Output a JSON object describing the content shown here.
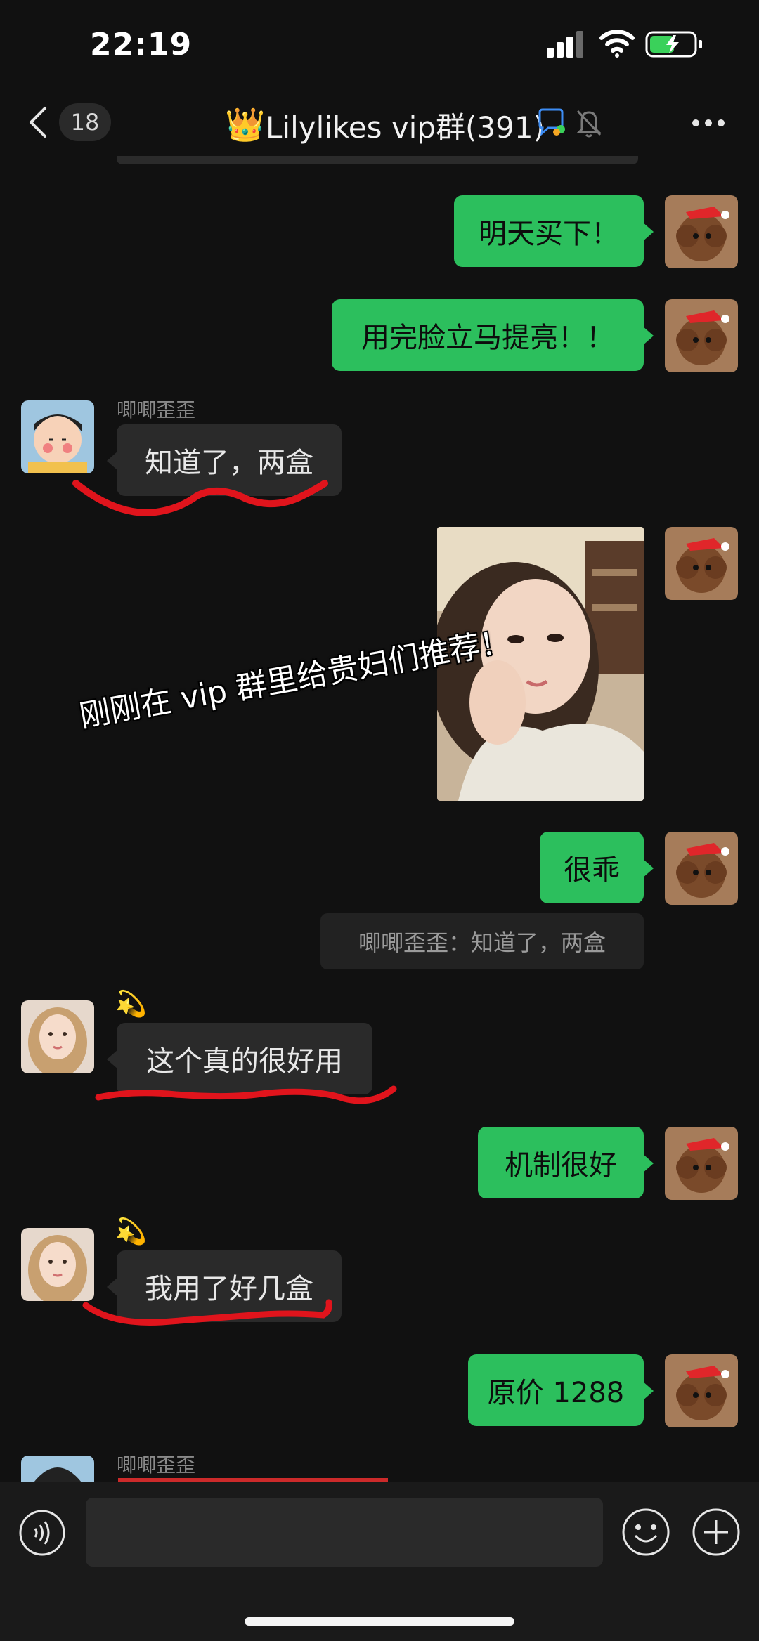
{
  "status_bar": {
    "time": "22:19"
  },
  "nav": {
    "unread_count": "18",
    "crown": "👑",
    "title": "Lilylikes vip群(391)"
  },
  "messages": [
    {
      "id": "m1",
      "direction": "out",
      "text": "明天买下！"
    },
    {
      "id": "m2",
      "direction": "out",
      "text": "用完脸立马提亮！！"
    },
    {
      "id": "m3",
      "direction": "in",
      "sender": "唧唧歪歪",
      "text": "知道了，两盒"
    },
    {
      "id": "m4",
      "direction": "out",
      "type": "image"
    },
    {
      "id": "m5",
      "direction": "out",
      "text": "很乖",
      "quote": "唧唧歪歪：知道了，两盒"
    },
    {
      "id": "m6",
      "direction": "in",
      "sender": "💫",
      "text": "这个真的很好用"
    },
    {
      "id": "m7",
      "direction": "out",
      "text": "机制很好"
    },
    {
      "id": "m8",
      "direction": "in",
      "sender": "💫",
      "text": "我用了好几盒"
    },
    {
      "id": "m9",
      "direction": "out",
      "text": "原价 1288"
    },
    {
      "id": "m10",
      "direction": "in",
      "sender": "唧唧歪歪"
    }
  ],
  "overlay_caption": "刚刚在 vip 群里给贵妇们推荐！",
  "colors": {
    "background": "#111111",
    "outgoing_bubble": "#2cbf5d",
    "incoming_bubble": "#2a2a2a",
    "annotation_red": "#e0141c"
  },
  "icons": {
    "back": "chevron-left-icon",
    "group_chat": "chat-bubble-icon",
    "mute": "bell-off-icon",
    "more": "more-dots-icon",
    "voice": "voice-icon",
    "emoji": "emoji-icon",
    "plus": "plus-icon"
  }
}
